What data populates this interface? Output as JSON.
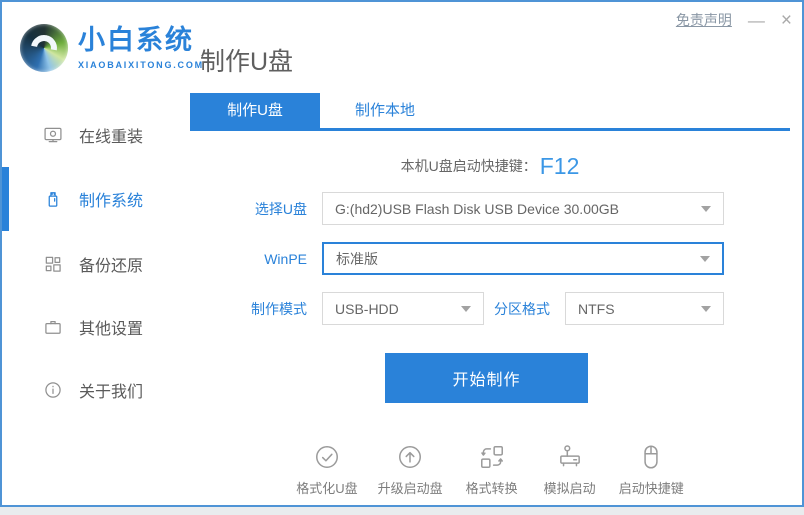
{
  "brand": {
    "name": "小白系统",
    "domain": "XIAOBAIXITONG.COM"
  },
  "page_title": "制作U盘",
  "titlebar": {
    "disclaimer": "免责声明",
    "minimize": "—",
    "close": "×"
  },
  "sidebar": {
    "items": [
      {
        "label": "在线重装",
        "icon": "monitor-icon",
        "active": false
      },
      {
        "label": "制作系统",
        "icon": "usb-drive-icon",
        "active": true
      },
      {
        "label": "备份还原",
        "icon": "backup-grid-icon",
        "active": false
      },
      {
        "label": "其他设置",
        "icon": "briefcase-icon",
        "active": false
      },
      {
        "label": "关于我们",
        "icon": "info-icon",
        "active": false
      }
    ]
  },
  "tabs": [
    {
      "label": "制作U盘",
      "active": true
    },
    {
      "label": "制作本地",
      "active": false
    }
  ],
  "main": {
    "hotkey_prefix": "本机U盘启动快捷键：",
    "hotkey_key": "F12",
    "usb_label": "选择U盘",
    "usb_value": "G:(hd2)USB Flash Disk USB Device 30.00GB",
    "winpe_label": "WinPE",
    "winpe_value": "标准版",
    "mode_label": "制作模式",
    "mode_value": "USB-HDD",
    "partition_label": "分区格式",
    "partition_value": "NTFS",
    "start_button": "开始制作"
  },
  "tools": [
    {
      "label": "格式化U盘",
      "icon": "check-circle-icon"
    },
    {
      "label": "升级启动盘",
      "icon": "arrow-up-circle-icon"
    },
    {
      "label": "格式转换",
      "icon": "format-convert-icon"
    },
    {
      "label": "模拟启动",
      "icon": "joystick-icon"
    },
    {
      "label": "启动快捷键",
      "icon": "mouse-icon"
    }
  ],
  "colors": {
    "accent": "#2a82d9",
    "window_border": "#4f94d6",
    "hotkey_blue": "#3b97e6",
    "inactive_icon": "#909090",
    "tool_icon": "#9b9b9b"
  }
}
